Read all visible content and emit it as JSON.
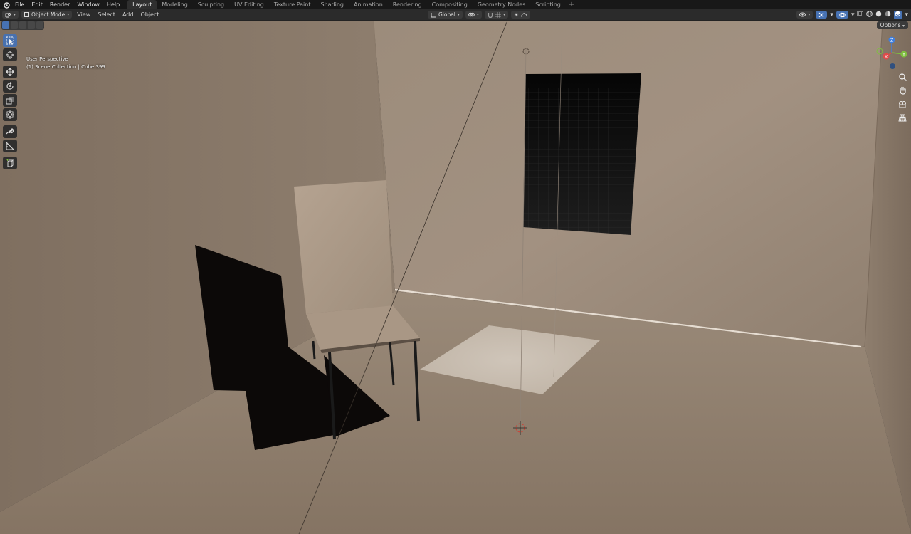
{
  "topbar": {
    "menus": [
      "File",
      "Edit",
      "Render",
      "Window",
      "Help"
    ],
    "workspaces": [
      {
        "label": "Layout",
        "active": true
      },
      {
        "label": "Modeling",
        "active": false
      },
      {
        "label": "Sculpting",
        "active": false
      },
      {
        "label": "UV Editing",
        "active": false
      },
      {
        "label": "Texture Paint",
        "active": false
      },
      {
        "label": "Shading",
        "active": false
      },
      {
        "label": "Animation",
        "active": false
      },
      {
        "label": "Rendering",
        "active": false
      },
      {
        "label": "Compositing",
        "active": false
      },
      {
        "label": "Geometry Nodes",
        "active": false
      },
      {
        "label": "Scripting",
        "active": false
      }
    ],
    "add_tab": "+"
  },
  "header": {
    "mode": "Object Mode",
    "menus": [
      "View",
      "Select",
      "Add",
      "Object"
    ],
    "transform_orientation": "Global",
    "options_label": "Options"
  },
  "viewport": {
    "view_name": "User Perspective",
    "collection_info": "(1) Scene Collection | Cube.399"
  },
  "toolbar": {
    "tools": [
      "select-box-tool",
      "cursor-tool",
      "move-tool",
      "rotate-tool",
      "scale-tool",
      "transform-tool",
      "annotate-tool",
      "measure-tool",
      "add-cube-tool"
    ]
  },
  "gizmo": {
    "x_label": "X",
    "y_label": "Y",
    "z_label": "Z"
  },
  "colors": {
    "active_accent": "#4772b3",
    "wall": "#9a8a78",
    "x_axis": "#e04a4a",
    "y_axis": "#7fbf3f",
    "z_axis": "#3f7fdf"
  }
}
